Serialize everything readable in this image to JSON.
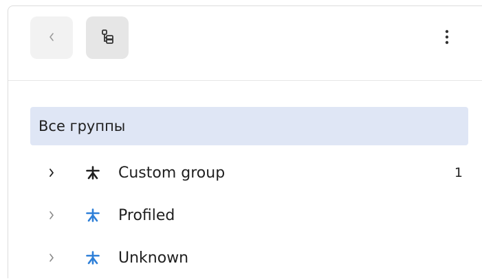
{
  "toolbar": {
    "back_icon": "chevron-left-icon",
    "tree_icon": "tree-structure-icon",
    "more_icon": "more-vertical-icon"
  },
  "group_header": {
    "label": "Все группы"
  },
  "tree": {
    "items": [
      {
        "label": "Custom group",
        "count": "1",
        "icon": "asterisk-icon",
        "icon_color": "#1f1f1f",
        "chevron_color": "#1f1f1f"
      },
      {
        "label": "Profiled",
        "count": "",
        "icon": "asterisk-icon",
        "icon_color": "#2d7fd8",
        "chevron_color": "#8a8a8a"
      },
      {
        "label": "Unknown",
        "count": "",
        "icon": "asterisk-icon",
        "icon_color": "#2d7fd8",
        "chevron_color": "#8a8a8a"
      }
    ]
  },
  "colors": {
    "header_bg": "#dfe6f5",
    "button_bg": "#f2f2f2",
    "button_active_bg": "#e6e6e6",
    "accent_blue": "#2d7fd8"
  }
}
